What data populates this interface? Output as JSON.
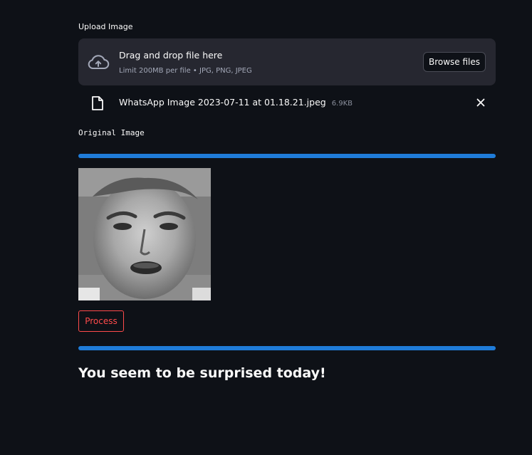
{
  "uploader": {
    "label": "Upload Image",
    "dropzone_title": "Drag and drop file here",
    "dropzone_limit": "Limit 200MB per file • JPG, PNG, JPEG",
    "browse_label": "Browse files",
    "cloud_icon": "cloud-upload-icon"
  },
  "uploaded_file": {
    "name": "WhatsApp Image 2023-07-11 at 01.18.21.jpeg",
    "size": "6.9KB",
    "file_icon": "file-icon",
    "remove_icon": "close-icon"
  },
  "original_image": {
    "label": "Original Image"
  },
  "process_button": {
    "label": "Process"
  },
  "result": {
    "text": "You seem to be surprised today!"
  },
  "colors": {
    "background": "#0e1117",
    "panel": "#262730",
    "divider": "#1f7cd9",
    "process_accent": "#ff4b4b"
  }
}
